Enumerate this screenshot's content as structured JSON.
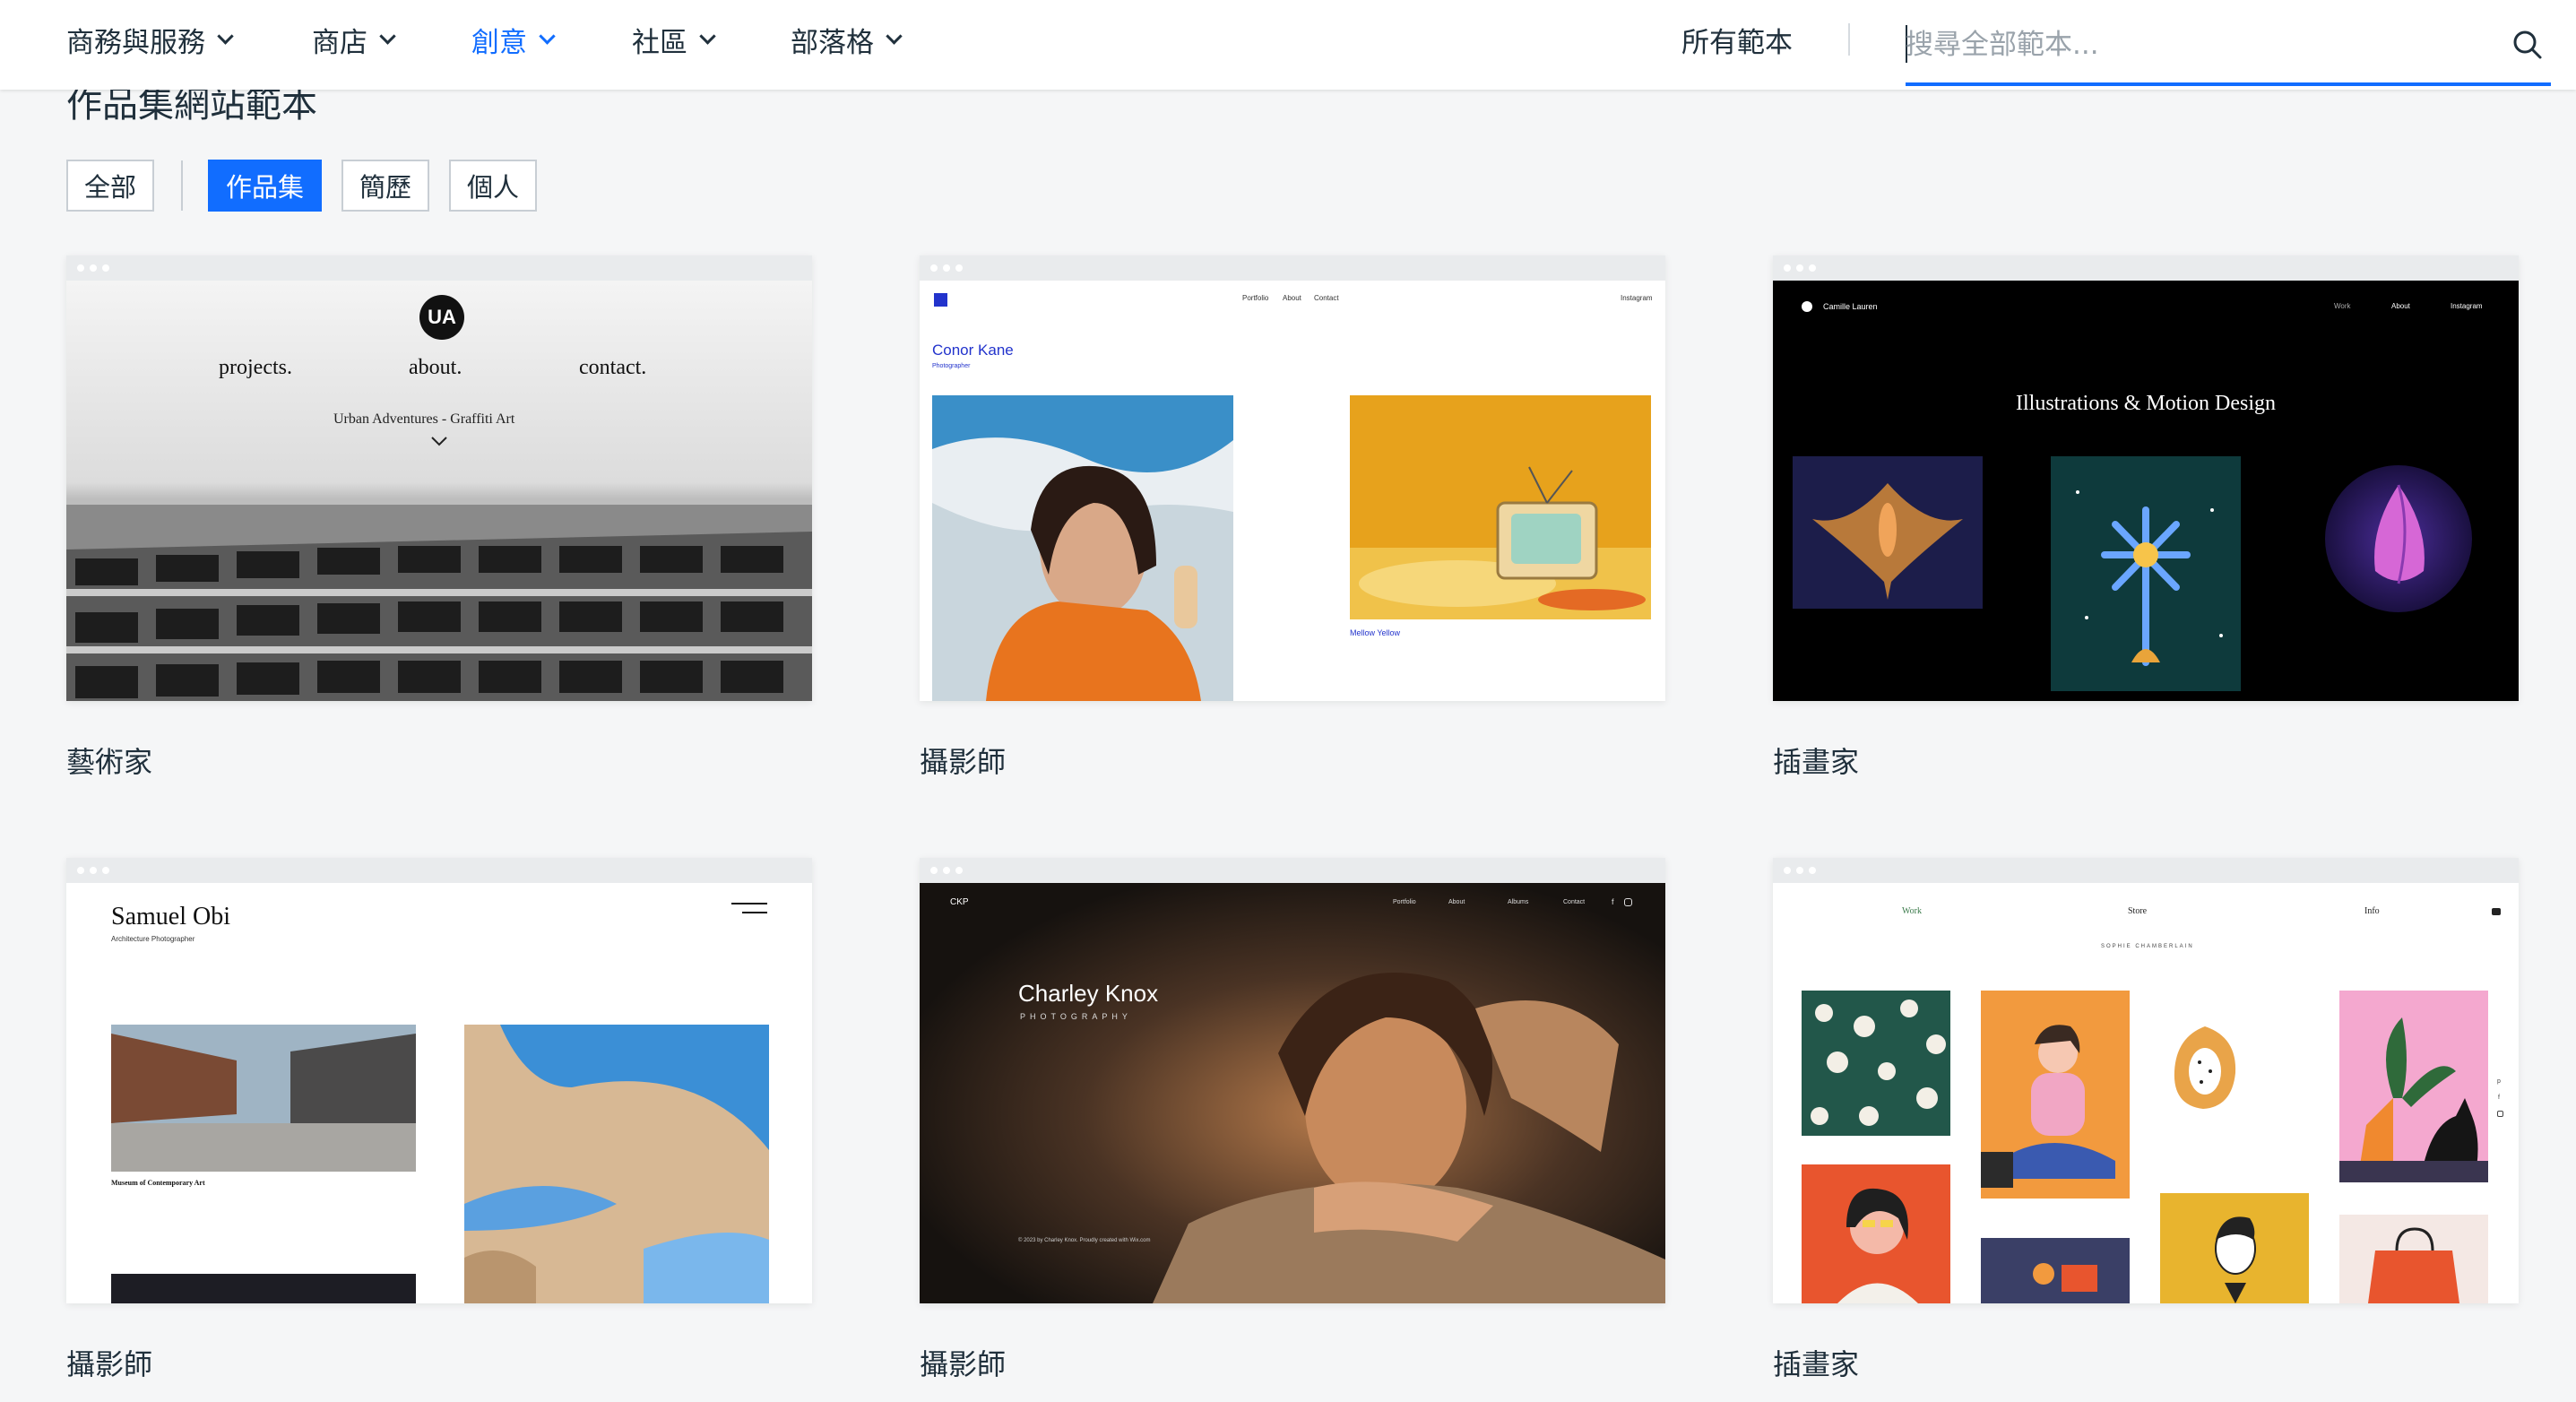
{
  "nav": {
    "items": [
      {
        "label": "商務與服務"
      },
      {
        "label": "商店"
      },
      {
        "label": "創意"
      },
      {
        "label": "社區"
      },
      {
        "label": "部落格"
      }
    ],
    "all_templates": "所有範本",
    "search_placeholder": "搜尋全部範本..."
  },
  "page": {
    "title": "作品集網站範本"
  },
  "filters": {
    "items": [
      {
        "label": "全部"
      },
      {
        "label": "作品集"
      },
      {
        "label": "簡歷"
      },
      {
        "label": "個人"
      }
    ],
    "active": "作品集"
  },
  "cards": [
    {
      "label": "藝術家",
      "preview": {
        "logo": "UA",
        "nav": [
          "projects.",
          "about.",
          "contact."
        ],
        "subtitle": "Urban Adventures - Graffiti Art"
      }
    },
    {
      "label": "攝影師",
      "preview": {
        "nav": [
          "Portfolio",
          "About",
          "Contact"
        ],
        "social": "Instagram",
        "name": "Conor Kane",
        "role": "Photographer",
        "caption": "Mellow Yellow"
      }
    },
    {
      "label": "插畫家",
      "preview": {
        "brand": "Camille Lauren",
        "nav": [
          "Work",
          "About",
          "Instagram"
        ],
        "headline": "Illustrations & Motion Design"
      }
    },
    {
      "label": "攝影師",
      "preview": {
        "name": "Samuel Obi",
        "role": "Architecture Photographer",
        "caption": "Museum of Contemporary Art"
      }
    },
    {
      "label": "攝影師",
      "preview": {
        "logo": "CKP",
        "nav": [
          "Portfolio",
          "About",
          "Albums",
          "Contact"
        ],
        "name": "Charley Knox",
        "role": "PHOTOGRAPHY",
        "footer": "© 2023 by Charley Knox. Proudly created with Wix.com"
      }
    },
    {
      "label": "插畫家",
      "preview": {
        "nav": [
          "Work",
          "Store",
          "Info"
        ],
        "brand": "SOPHIE CHAMBERLAIN"
      }
    }
  ],
  "colors": {
    "accent": "#116dff",
    "text": "#20303c",
    "background": "#f5f6f7"
  }
}
